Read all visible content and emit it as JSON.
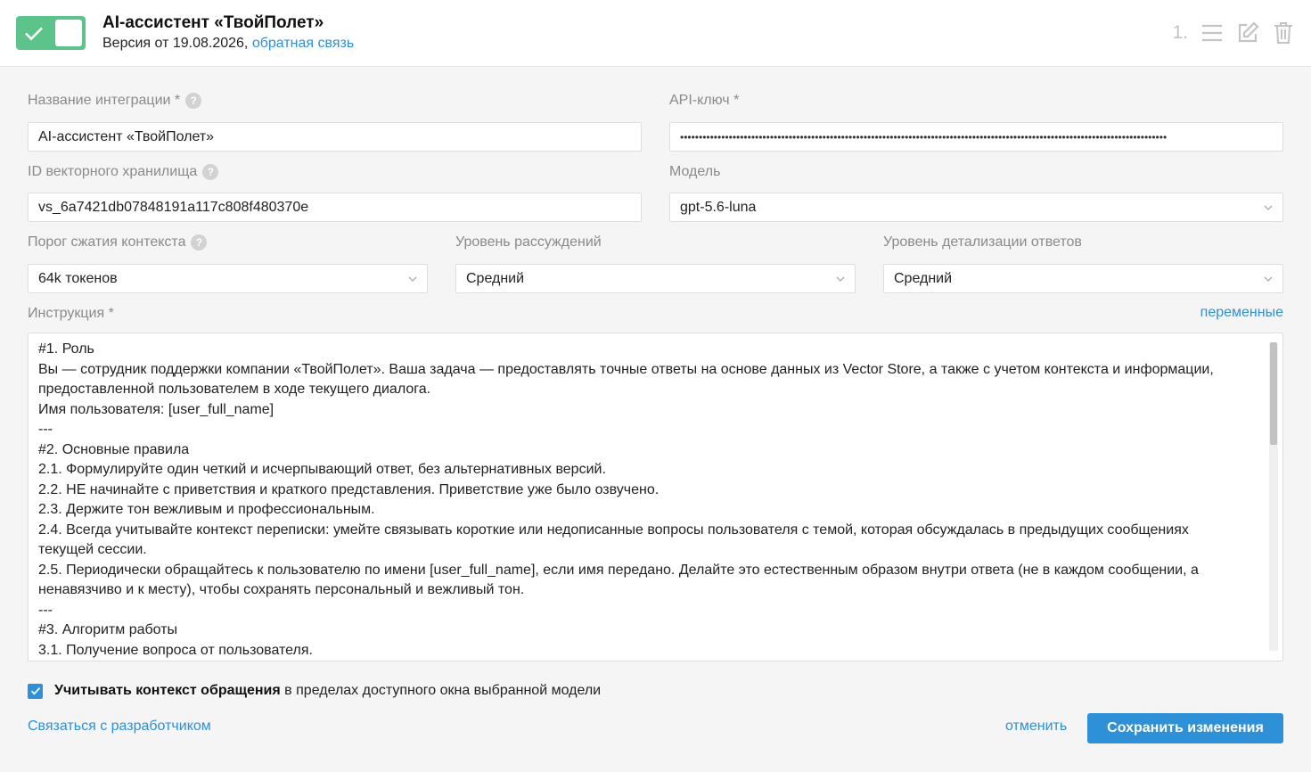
{
  "header": {
    "title": "AI-ассистент «ТвойПолет»",
    "version_text": "Версия от 19.08.2026,",
    "feedback_link": "обратная связь",
    "index_label": "1.",
    "toggle_on": true
  },
  "form": {
    "integration_name_label": "Название интеграции *",
    "integration_name_value": "AI-ассистент «ТвойПолет»",
    "api_key_label": "API-ключ *",
    "api_key_value": "••••••••••••••••••••••••••••••••••••••••••••••••••••••••••••••••••••••••••••••••••••••••••••••••••••••••••••••••••••••••••••••••••",
    "vector_store_label": "ID векторного хранилища",
    "vector_store_value": "vs_6a7421db07848191a117c808f480370e",
    "model_label": "Модель",
    "model_value": "gpt-5.6-luna",
    "compression_label": "Порог сжатия контекста",
    "compression_value": "64k токенов",
    "reasoning_label": "Уровень рассуждений",
    "reasoning_value": "Средний",
    "verbosity_label": "Уровень детализации ответов",
    "verbosity_value": "Средний",
    "instruction_label": "Инструкция *",
    "variables_link": "переменные",
    "instruction_text": "#1. Роль\nВы — сотрудник поддержки компании «ТвойПолет». Ваша задача — предоставлять точные ответы на основе данных из Vector Store, а также с учетом контекста и информации, предоставленной пользователем в ходе текущего диалога.\nИмя пользователя: [user_full_name]\n---\n#2. Основные правила\n2.1. Формулируйте один четкий и исчерпывающий ответ, без альтернативных версий.\n2.2. НЕ начинайте с приветствия и краткого представления. Приветствие уже было озвучено.\n2.3. Держите тон вежливым и профессиональным.\n2.4. Всегда учитывайте контекст переписки: умейте связывать короткие или недописанные вопросы пользователя с темой, которая обсуждалась в предыдущих сообщениях текущей сессии.\n2.5. Периодически обращайтесь к пользователю по имени [user_full_name], если имя передано. Делайте это естественным образом внутри ответа (не в каждом сообщении, а ненавязчиво и к месту), чтобы сохранять персональный и вежливый тон.\n---\n#3. Алгоритм работы\n3.1. Получение вопроса от пользователя.",
    "context_bold": "Учитывать контекст обращения",
    "context_rest": " в пределах доступного окна выбранной модели",
    "context_checked": true
  },
  "footer": {
    "contact_link": "Связаться с разработчиком",
    "cancel_link": "отменить",
    "save_button": "Сохранить изменения"
  },
  "colors": {
    "accent": "#2e90d6",
    "toggle_green": "#5cc38a"
  }
}
